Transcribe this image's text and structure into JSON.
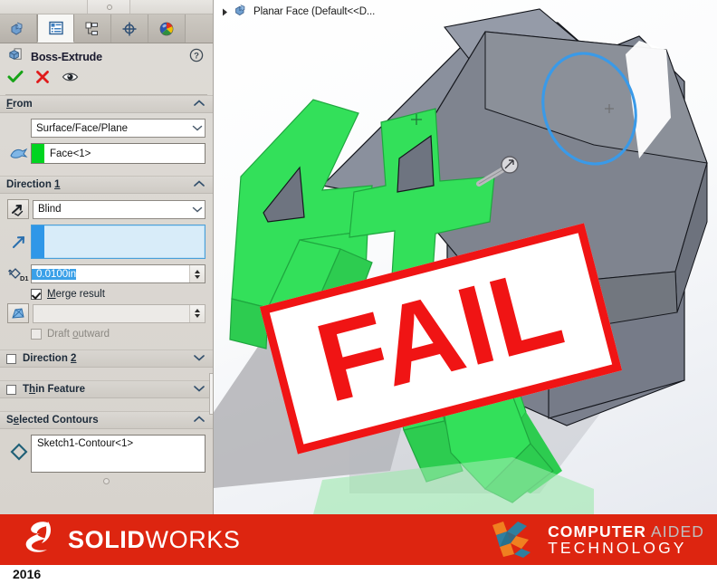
{
  "panel": {
    "tabs": [
      {
        "name": "feature-manager-tree-tab",
        "icon": "part-tree-icon",
        "active": false
      },
      {
        "name": "property-manager-tab",
        "icon": "property-list-icon",
        "active": true
      },
      {
        "name": "configuration-manager-tab",
        "icon": "configuration-icon",
        "active": false
      },
      {
        "name": "display-manager-tab",
        "icon": "display-crosshair-icon",
        "active": false
      },
      {
        "name": "appearances-tab",
        "icon": "appearance-sphere-icon",
        "active": false
      }
    ],
    "header": {
      "title": "Boss-Extrude",
      "help_label": "?",
      "ok_label": "OK",
      "cancel_label": "Cancel",
      "preview_label": "Preview"
    },
    "from": {
      "title": "From",
      "title_plain": "F",
      "title_underline": "rom",
      "condition": "Surface/Face/Plane",
      "face_value": "Face<1>",
      "swatch_color": "#00d420"
    },
    "direction1": {
      "title": "Direction ",
      "title_underline": "1",
      "end_condition": "Blind",
      "direction_value": "",
      "depth_value": "0.0100in",
      "merge_label_plain": "M",
      "merge_label_rest": "erge result",
      "merge_checked": true,
      "draft_angle_value": "",
      "draft_outward_plain": "Draft ",
      "draft_outward_underline": "o",
      "draft_outward_rest": "utward",
      "draft_outward_checked": false
    },
    "direction2": {
      "title": "Direction ",
      "title_underline": "2",
      "checked": false
    },
    "thin_feature": {
      "title_plain": "T",
      "title_underline": "h",
      "title_rest": "in Feature",
      "checked": false
    },
    "selected_contours": {
      "title_plain": "S",
      "title_underline": "e",
      "title_rest": "lected Contours",
      "value": "Sketch1-Contour<1>"
    }
  },
  "viewport": {
    "tree_label": "Planar Face  (Default<<D...",
    "tree_icon": "part-icon",
    "expand_icon": "triangle-right-icon",
    "fail_stamp": "FAIL",
    "colors": {
      "model_face": "#7a7f8c",
      "model_face_light": "#8d93a0",
      "extrude_green": "#33e05a",
      "selection_blue": "#3a9ae8",
      "stamp_red": "#f01414"
    }
  },
  "banner": {
    "solidworks_bold": "SOLID",
    "solidworks_thin": "WORKS",
    "cat_line1_bold": "COMPUTER",
    "cat_line1_grey": " AIDED",
    "cat_line2": "TECHNOLOGY",
    "background_color": "#dd2510"
  },
  "footer": {
    "year": "2016"
  }
}
